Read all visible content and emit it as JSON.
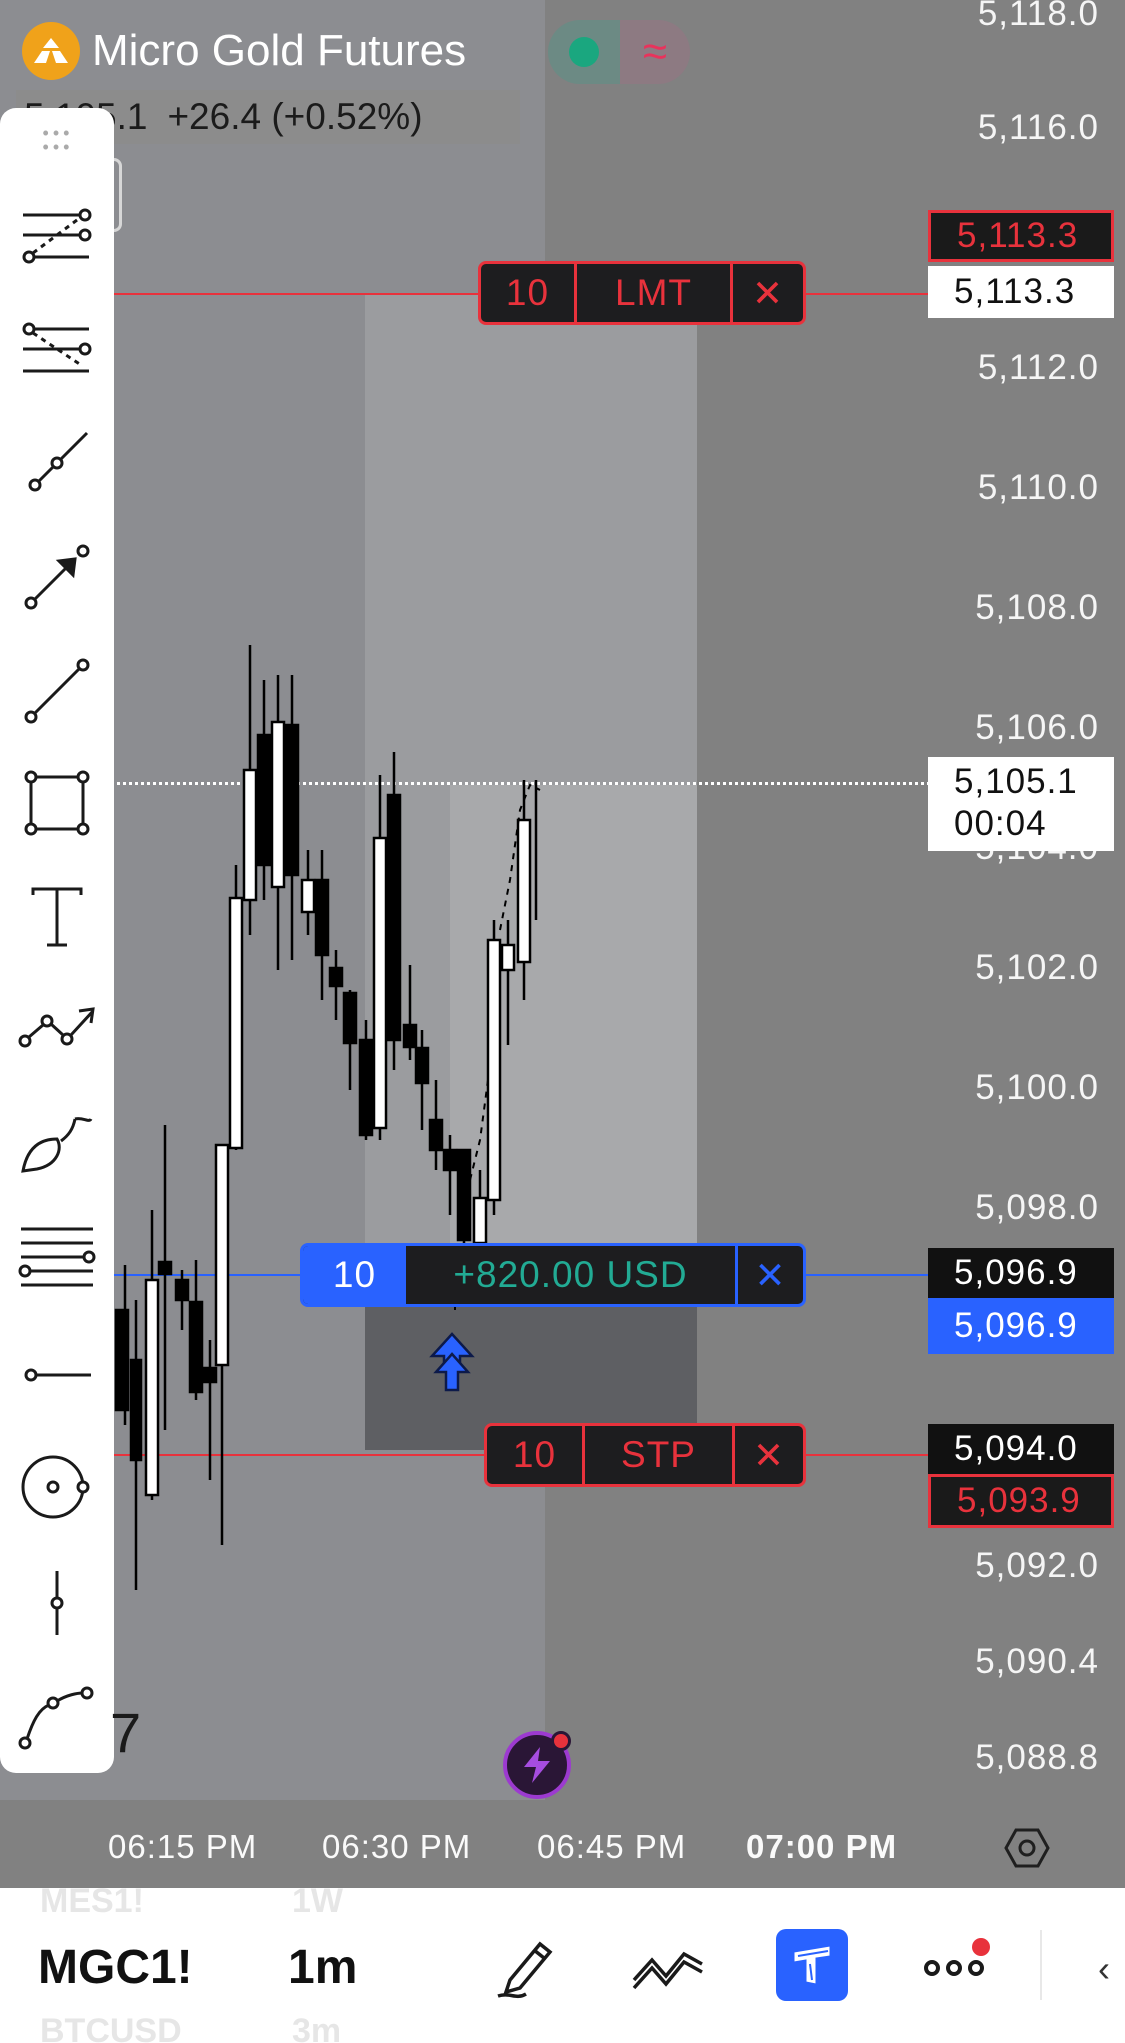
{
  "symbol": {
    "name": "Micro Gold Futures",
    "price_info": "5,105.1",
    "change": "+26.4 (+0.52%)"
  },
  "price_axis": {
    "ticks": [
      "5,118.0",
      "5,116.0",
      "5,112.0",
      "5,110.0",
      "5,108.0",
      "5,106.0",
      "5,102.0",
      "5,100.0",
      "5,098.0",
      "5,092.0",
      "5,090.4",
      "5,088.8"
    ],
    "hidden_tick": "5,104.0"
  },
  "current": {
    "price": "5,105.1",
    "countdown": "00:04"
  },
  "limit_order": {
    "qty": "10",
    "type": "LMT",
    "close": "✕",
    "ask": "5,113.3",
    "bid": "5,113.3"
  },
  "position": {
    "qty": "10",
    "pnl": "+820.00 USD",
    "close": "✕",
    "price_a": "5,096.9",
    "price_b": "5,096.9"
  },
  "stop_order": {
    "qty": "10",
    "type": "STP",
    "close": "✕",
    "price_a": "5,094.0",
    "price_b": "5,093.9"
  },
  "time_axis": {
    "labels": [
      "06:15 PM",
      "06:30 PM",
      "06:45 PM",
      "07:00 PM"
    ]
  },
  "toolbar": {
    "symbol": "MGC1!",
    "interval": "1m",
    "prev_symbol": "MES1!",
    "prev_interval": "1W",
    "next_symbol": "BTCUSD",
    "next_interval": "3m"
  },
  "partial_digit": "7",
  "colors": {
    "red": "#e8323c",
    "blue": "#2962ff",
    "green": "#22ab94",
    "bg": "#818181"
  }
}
